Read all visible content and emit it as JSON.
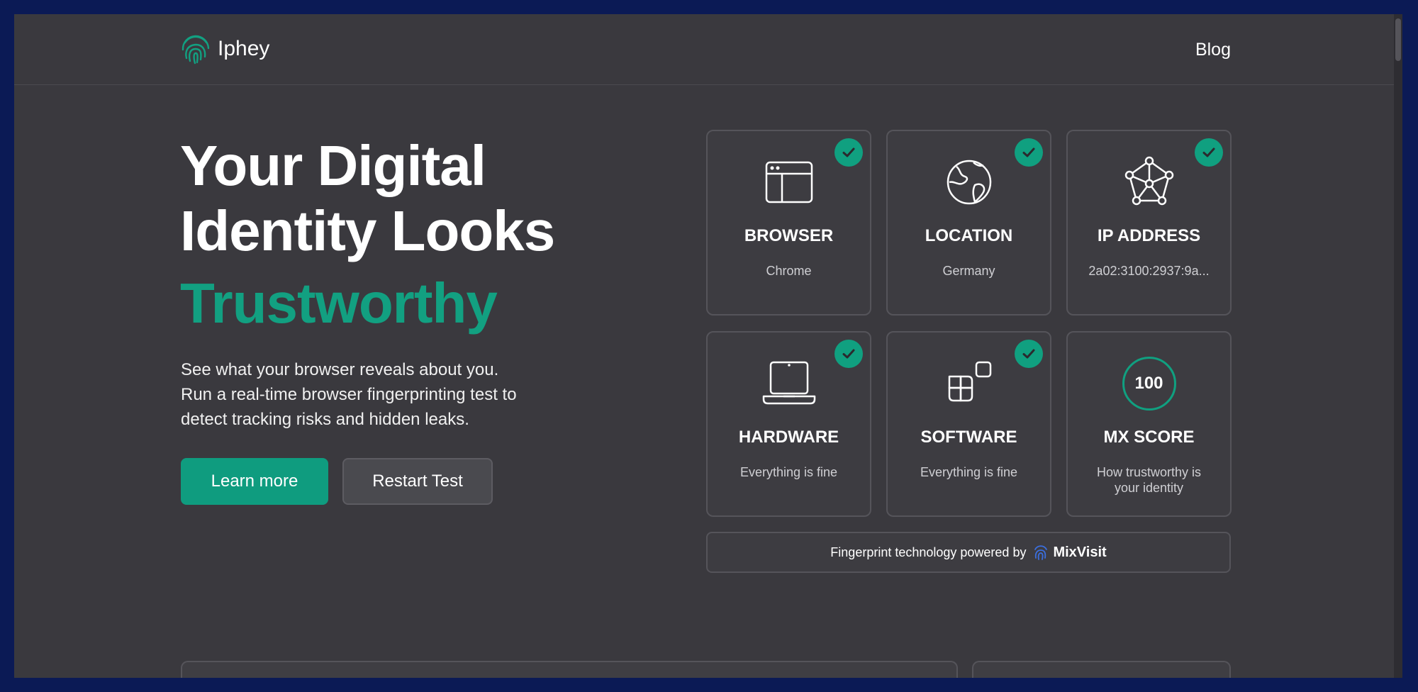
{
  "header": {
    "logo_text": "Iphey",
    "blog_label": "Blog"
  },
  "hero": {
    "title_line1": "Your Digital",
    "title_line2": "Identity Looks",
    "title_accent": "Trustworthy",
    "description": "See what your browser reveals about you. Run a real-time browser fingerprinting test to detect tracking risks and hidden leaks.",
    "learn_more_label": "Learn more",
    "restart_label": "Restart Test"
  },
  "cards": [
    {
      "title": "BROWSER",
      "value": "Chrome",
      "icon": "browser-window-icon",
      "checked": true
    },
    {
      "title": "LOCATION",
      "value": "Germany",
      "icon": "globe-icon",
      "checked": true
    },
    {
      "title": "IP ADDRESS",
      "value": "2a02:3100:2937:9a...",
      "icon": "network-icon",
      "checked": true
    },
    {
      "title": "HARDWARE",
      "value": "Everything is fine",
      "icon": "laptop-icon",
      "checked": true
    },
    {
      "title": "SOFTWARE",
      "value": "Everything is fine",
      "icon": "apps-icon",
      "checked": true
    },
    {
      "title": "MX SCORE",
      "value": "How trustworthy is your identity",
      "score": "100",
      "checked": false
    }
  ],
  "powered": {
    "text": "Fingerprint technology powered by",
    "brand": "MixVisit"
  },
  "colors": {
    "accent": "#10a080",
    "background": "#3a393e",
    "frame": "#0b1a55"
  }
}
